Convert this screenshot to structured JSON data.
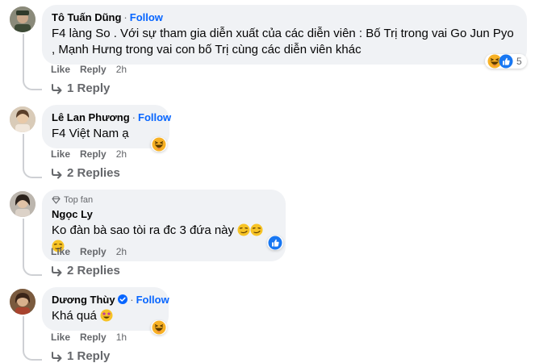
{
  "comments": [
    {
      "author": "Tô Tuấn Dũng",
      "follow": "Follow",
      "text": "F4 làng So . Với sự tham gia diễn xuất của các diễn viên : Bố Trị trong vai Go Jun Pyo , Mạnh Hưng trong vai con bố Trị cùng các diễn viên khác",
      "like": "Like",
      "reply": "Reply",
      "time": "2h",
      "reaction_count": "5",
      "replies": "1 Reply"
    },
    {
      "author": "Lê Lan Phương",
      "follow": "Follow",
      "text": "F4 Việt Nam ạ",
      "like": "Like",
      "reply": "Reply",
      "time": "2h",
      "replies": "2 Replies"
    },
    {
      "badge": "Top fan",
      "author": "Ngọc Ly",
      "text": "Ko đàn bà sao tòi ra đc 3 đứa này",
      "like": "Like",
      "reply": "Reply",
      "time": "2h",
      "replies": "2 Replies"
    },
    {
      "author": "Dương Thùy",
      "follow": "Follow",
      "text": "Khá quá",
      "like": "Like",
      "reply": "Reply",
      "time": "1h",
      "replies": "1 Reply"
    }
  ],
  "colors": {
    "link": "#0866ff",
    "bubble": "#f0f2f5",
    "meta": "#65676b"
  }
}
